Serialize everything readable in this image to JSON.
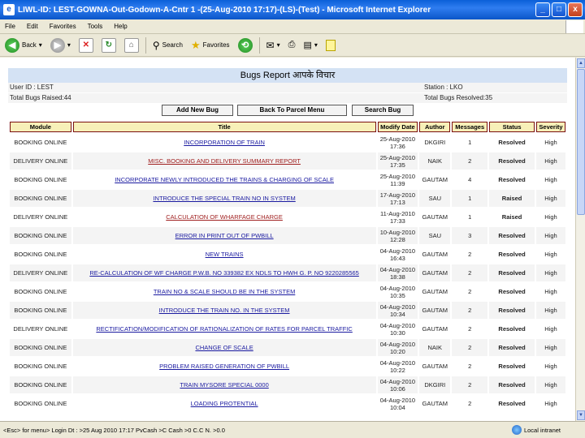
{
  "window": {
    "title": "LIWL-ID: LEST-GOWNA-Out-Godown-A-Cntr 1 -(25-Aug-2010 17:17)-(LS)-(Test) - Microsoft Internet Explorer",
    "min": "_",
    "max": "□",
    "close": "x"
  },
  "menu": [
    "File",
    "Edit",
    "Favorites",
    "Tools",
    "Help"
  ],
  "toolbar": {
    "back": "Back",
    "search": "Search",
    "favorites": "Favorites"
  },
  "report": {
    "title": "Bugs Report  आपके विचार",
    "user_id": "User ID : LEST",
    "station": "Station : LKO",
    "total_raised": "Total Bugs Raised:44",
    "total_resolved": "Total Bugs Resolved:35"
  },
  "buttons": {
    "add_new_bug": "Add New Bug",
    "back_to_parcel_menu": "Back To Parcel Menu",
    "search_bug": "Search Bug"
  },
  "table": {
    "headers": [
      "Module",
      "Title",
      "Modify Date",
      "Author",
      "Messages",
      "Status",
      "Severity"
    ],
    "rows": [
      {
        "module": "BOOKING ONLINE",
        "title": "INCORPORATION OF TRAIN",
        "date": "25-Aug-2010 17:36",
        "author": "DKGIRI",
        "messages": "1",
        "status": "Resolved",
        "severity": "High",
        "red": false
      },
      {
        "module": "DELIVERY ONLINE",
        "title": "MISC. BOOKING AND DELIVERY SUMMARY REPORT",
        "date": "25-Aug-2010 17:35",
        "author": "NAIK",
        "messages": "2",
        "status": "Resolved",
        "severity": "High",
        "red": true
      },
      {
        "module": "BOOKING ONLINE",
        "title": "INCORPORATE NEWLY INTRODUCED THE TRAINS & CHARGING OF SCALE",
        "date": "25-Aug-2010 11:39",
        "author": "GAUTAM",
        "messages": "4",
        "status": "Resolved",
        "severity": "High",
        "red": false
      },
      {
        "module": "BOOKING ONLINE",
        "title": "INTRODUCE THE SPECIAL TRAIN NO IN SYSTEM",
        "date": "17-Aug-2010 17:13",
        "author": "SAU",
        "messages": "1",
        "status": "Raised",
        "severity": "High",
        "red": false
      },
      {
        "module": "DELIVERY ONLINE",
        "title": "CALCULATION OF WHARFAGE CHARGE",
        "date": "11-Aug-2010 17:33",
        "author": "GAUTAM",
        "messages": "1",
        "status": "Raised",
        "severity": "High",
        "red": true
      },
      {
        "module": "BOOKING ONLINE",
        "title": "ERROR IN PRINT OUT OF PWBILL",
        "date": "10-Aug-2010 12:28",
        "author": "SAU",
        "messages": "3",
        "status": "Resolved",
        "severity": "High",
        "red": false
      },
      {
        "module": "BOOKING ONLINE",
        "title": "NEW TRAINS",
        "date": "04-Aug-2010 16:43",
        "author": "GAUTAM",
        "messages": "2",
        "status": "Resolved",
        "severity": "High",
        "red": false
      },
      {
        "module": "DELIVERY ONLINE",
        "title": "RE-CALCULATION OF WF CHARGE P.W.B. NO 339382 EX NDLS TO HWH G. P. NO 9220285565",
        "date": "04-Aug-2010 18:38",
        "author": "GAUTAM",
        "messages": "2",
        "status": "Resolved",
        "severity": "High",
        "red": false
      },
      {
        "module": "BOOKING ONLINE",
        "title": "TRAIN NO & SCALE SHOULD BE IN THE SYSTEM",
        "date": "04-Aug-2010 10:35",
        "author": "GAUTAM",
        "messages": "2",
        "status": "Resolved",
        "severity": "High",
        "red": false
      },
      {
        "module": "BOOKING ONLINE",
        "title": "INTRODUCE THE TRAIN NO. IN THE SYSTEM",
        "date": "04-Aug-2010 10:34",
        "author": "GAUTAM",
        "messages": "2",
        "status": "Resolved",
        "severity": "High",
        "red": false
      },
      {
        "module": "DELIVERY ONLINE",
        "title": "RECTIFICATION/MODIFICATION OF RATIONALIZATION OF RATES FOR PARCEL TRAFFIC",
        "date": "04-Aug-2010 10:30",
        "author": "GAUTAM",
        "messages": "2",
        "status": "Resolved",
        "severity": "High",
        "red": false
      },
      {
        "module": "BOOKING ONLINE",
        "title": "CHANGE OF SCALE",
        "date": "04-Aug-2010 10:20",
        "author": "NAIK",
        "messages": "2",
        "status": "Resolved",
        "severity": "High",
        "red": false
      },
      {
        "module": "BOOKING ONLINE",
        "title": "PROBLEM RAISED GENERATION OF PWBILL",
        "date": "04-Aug-2010 10:22",
        "author": "GAUTAM",
        "messages": "2",
        "status": "Resolved",
        "severity": "High",
        "red": false
      },
      {
        "module": "BOOKING ONLINE",
        "title": "TRAIN MYSORE SPECIAL 0000",
        "date": "04-Aug-2010 10:06",
        "author": "DKGIRI",
        "messages": "2",
        "status": "Resolved",
        "severity": "High",
        "red": false
      },
      {
        "module": "BOOKING ONLINE",
        "title": "LOADING PROTENTIAL",
        "date": "04-Aug-2010 10:04",
        "author": "GAUTAM",
        "messages": "2",
        "status": "Resolved",
        "severity": "High",
        "red": false
      }
    ]
  },
  "statusbar": {
    "text": "<Esc> for menu> Login Dt : >25 Aug 2010 17:17 PvCash >C Cash >0 C.C N. >0.0",
    "zone": "Local intranet"
  }
}
